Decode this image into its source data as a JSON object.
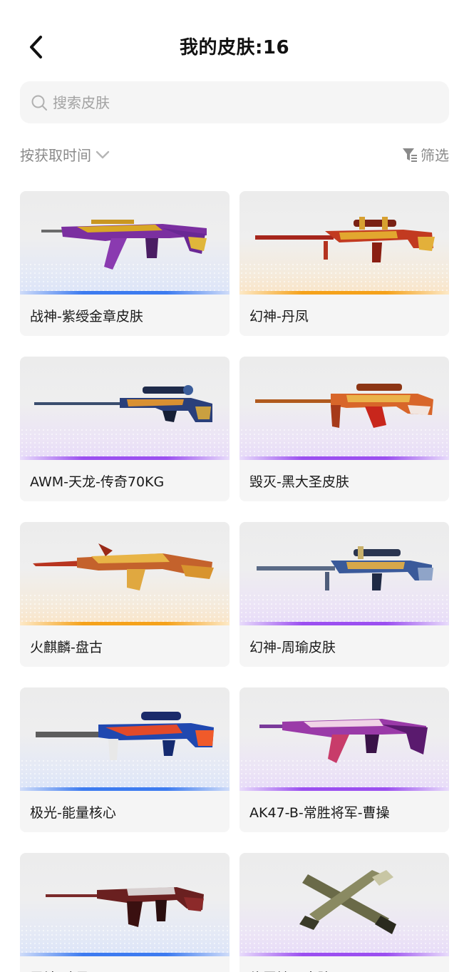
{
  "header": {
    "title": "我的皮肤:16"
  },
  "search": {
    "placeholder": "搜索皮肤"
  },
  "toolbar": {
    "sort_label": "按获取时间",
    "filter_label": "筛选"
  },
  "colors": {
    "blue": "#3d7bf0",
    "orange": "#f5a21b",
    "purple": "#9b4ff0"
  },
  "skins": [
    {
      "name": "战神-紫绶金章皮肤",
      "rarity": "blue",
      "icon": "rifle-icon"
    },
    {
      "name": "幻神-丹凤",
      "rarity": "orange",
      "icon": "sniper-rifle-icon"
    },
    {
      "name": "AWM-天龙-传奇70KG",
      "rarity": "purple",
      "icon": "sniper-rifle-icon"
    },
    {
      "name": "毁灭-黑大圣皮肤",
      "rarity": "purple",
      "icon": "sniper-rifle-icon"
    },
    {
      "name": "火麒麟-盘古",
      "rarity": "orange",
      "icon": "rifle-icon"
    },
    {
      "name": "幻神-周瑜皮肤",
      "rarity": "purple",
      "icon": "sniper-rifle-icon"
    },
    {
      "name": "极光-能量核心",
      "rarity": "blue",
      "icon": "sniper-rifle-icon"
    },
    {
      "name": "AK47-B-常胜将军-曹操",
      "rarity": "purple",
      "icon": "rifle-icon"
    },
    {
      "name": "雷神-暗星",
      "rarity": "blue",
      "icon": "rifle-icon"
    },
    {
      "name": "修罗镰刀皮肤",
      "rarity": "purple",
      "icon": "knife-pistol-icon"
    }
  ]
}
